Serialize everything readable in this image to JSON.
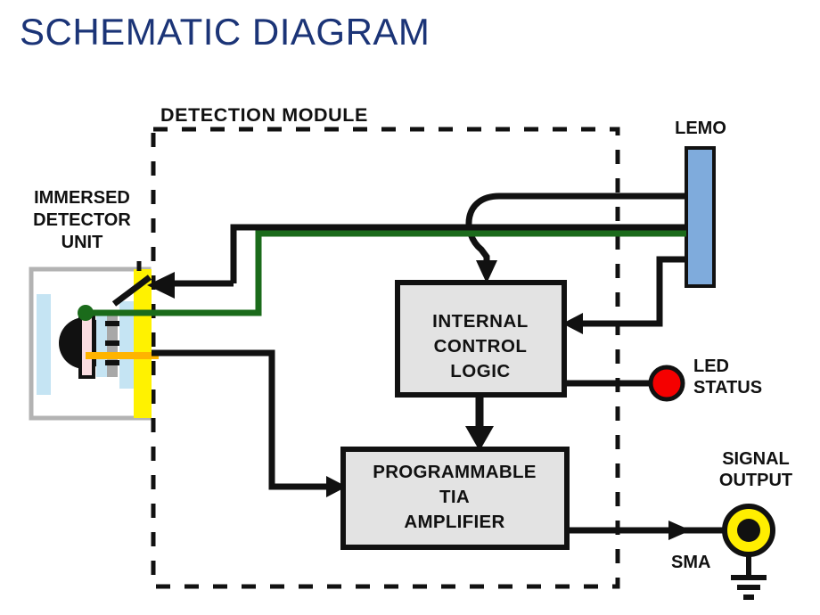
{
  "page": {
    "title": "SCHEMATIC DIAGRAM",
    "title_color": "#1b3477",
    "background": "#ffffff"
  },
  "diagram": {
    "type": "block-schematic",
    "boundary": {
      "label": "DETECTION MODULE",
      "style": "dashed",
      "color": "#111111"
    },
    "labels": {
      "immersed_detector_unit_line1": "IMMERSED",
      "immersed_detector_unit_line2": "DETECTOR",
      "immersed_detector_unit_line3": "UNIT",
      "lemo": "LEMO",
      "led_status_line1": "LED",
      "led_status_line2": "STATUS",
      "signal_output_line1": "SIGNAL",
      "signal_output_line2": "OUTPUT",
      "sma": "SMA"
    },
    "blocks": [
      {
        "id": "internal-control-logic",
        "lines": [
          "INTERNAL",
          "CONTROL",
          "LOGIC"
        ],
        "fill": "#e3e3e3",
        "stroke": "#111111"
      },
      {
        "id": "programmable-tia-amplifier",
        "lines": [
          "PROGRAMMABLE",
          "TIA",
          "AMPLIFIER"
        ],
        "fill": "#e3e3e3",
        "stroke": "#111111"
      }
    ],
    "components": [
      {
        "id": "lemo-connector",
        "label": "LEMO",
        "color": "#7fabdc",
        "stroke": "#111111",
        "shape": "rectangle"
      },
      {
        "id": "led-status-indicator",
        "label": "LED STATUS",
        "color": "#f50000",
        "stroke": "#111111",
        "shape": "circle"
      },
      {
        "id": "sma-connector",
        "label": "SMA",
        "color": "#ffee00",
        "center_color": "#111111",
        "stroke": "#111111",
        "shape": "circle-ground"
      },
      {
        "id": "detector-faceplate",
        "color": "#fff200"
      },
      {
        "id": "detector-housing",
        "color": "#b3b3b3"
      },
      {
        "id": "detector-window",
        "color": "#c5e4f3"
      },
      {
        "id": "detector-lens",
        "color": "#111111"
      },
      {
        "id": "detector-substrate",
        "color": "#fadde1"
      }
    ],
    "wires": [
      {
        "id": "wire-bias-black",
        "color": "#111111"
      },
      {
        "id": "wire-ground-green",
        "color": "#1b6b1b"
      },
      {
        "id": "wire-signal-orange",
        "color": "#ffb400"
      },
      {
        "id": "wire-lemo-to-control",
        "color": "#111111"
      },
      {
        "id": "wire-control-to-tia",
        "color": "#111111"
      },
      {
        "id": "wire-control-to-led",
        "color": "#111111"
      },
      {
        "id": "wire-tia-to-sma",
        "color": "#111111"
      },
      {
        "id": "wire-detector-to-tia",
        "color": "#111111"
      }
    ]
  }
}
